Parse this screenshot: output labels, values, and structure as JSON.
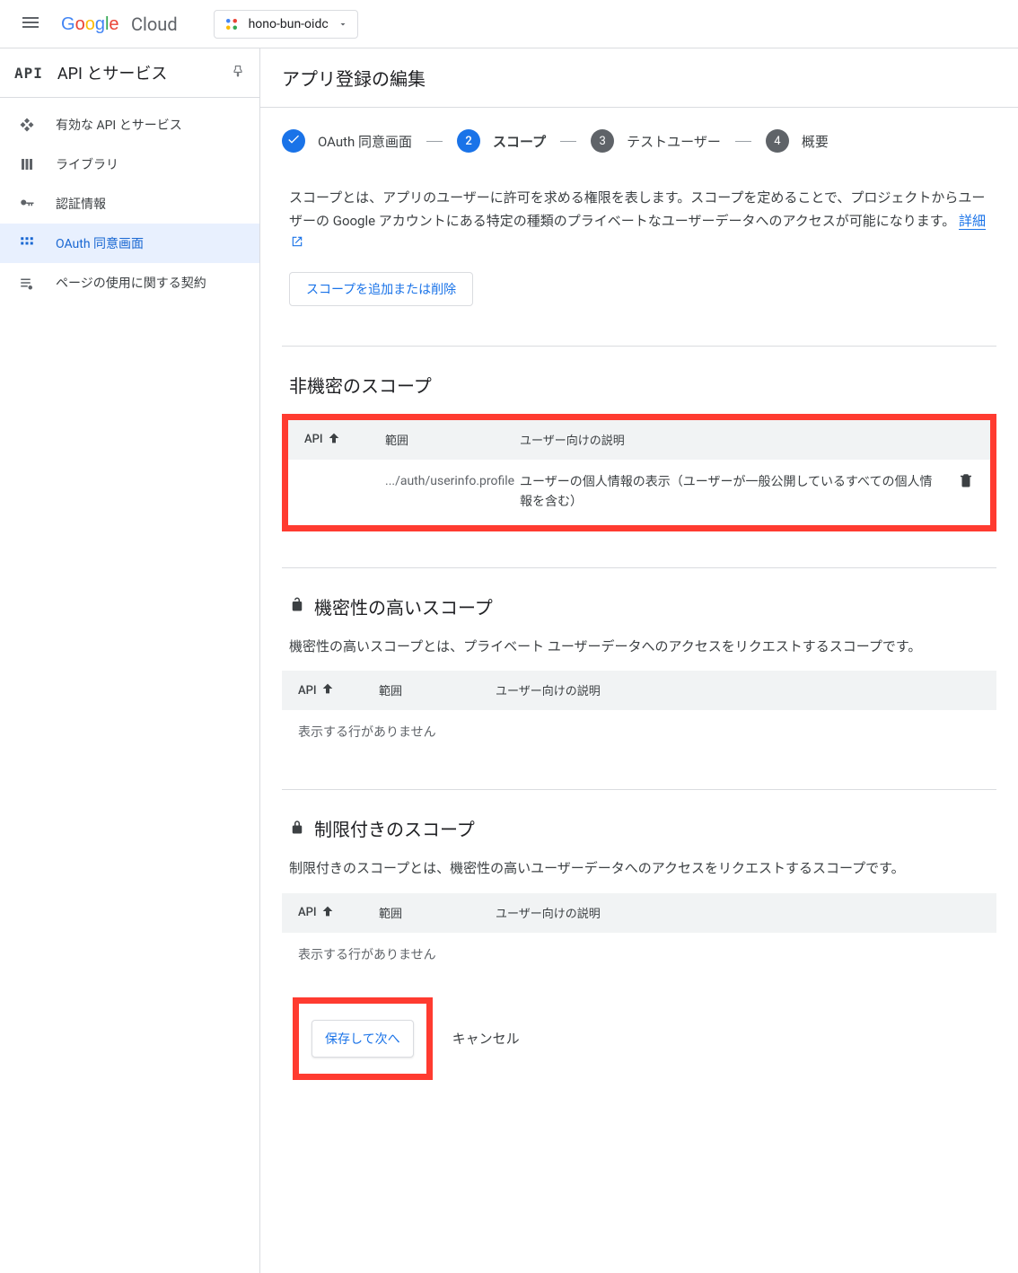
{
  "topbar": {
    "logo_cloud": "Cloud",
    "project": "hono-bun-oidc"
  },
  "sidebar": {
    "title": "API とサービス",
    "api_badge": "API",
    "items": [
      {
        "label": "有効な API とサービス"
      },
      {
        "label": "ライブラリ"
      },
      {
        "label": "認証情報"
      },
      {
        "label": "OAuth 同意画面"
      },
      {
        "label": "ページの使用に関する契約"
      }
    ]
  },
  "page": {
    "title": "アプリ登録の編集"
  },
  "stepper": {
    "steps": [
      {
        "label": "OAuth 同意画面"
      },
      {
        "label": "スコープ",
        "num": "2"
      },
      {
        "label": "テストユーザー",
        "num": "3"
      },
      {
        "label": "概要",
        "num": "4"
      }
    ]
  },
  "scopes": {
    "description": "スコープとは、アプリのユーザーに許可を求める権限を表します。スコープを定めることで、プロジェクトからユーザーの Google アカウントにある特定の種類のプライベートなユーザーデータへのアクセスが可能になります。",
    "learn_more": "詳細",
    "add_button": "スコープを追加または削除",
    "non_sensitive": {
      "title": "非機密のスコープ",
      "headers": {
        "api": "API",
        "scope": "範囲",
        "desc": "ユーザー向けの説明"
      },
      "rows": [
        {
          "api": "",
          "scope": ".../auth/userinfo.profile",
          "desc": "ユーザーの個人情報の表示（ユーザーが一般公開しているすべての個人情報を含む）"
        }
      ]
    },
    "sensitive": {
      "title": "機密性の高いスコープ",
      "desc": "機密性の高いスコープとは、プライベート ユーザーデータへのアクセスをリクエストするスコープです。",
      "headers": {
        "api": "API",
        "scope": "範囲",
        "desc": "ユーザー向けの説明"
      },
      "empty": "表示する行がありません"
    },
    "restricted": {
      "title": "制限付きのスコープ",
      "desc": "制限付きのスコープとは、機密性の高いユーザーデータへのアクセスをリクエストするスコープです。",
      "headers": {
        "api": "API",
        "scope": "範囲",
        "desc": "ユーザー向けの説明"
      },
      "empty": "表示する行がありません"
    }
  },
  "footer": {
    "save_next": "保存して次へ",
    "cancel": "キャンセル"
  }
}
